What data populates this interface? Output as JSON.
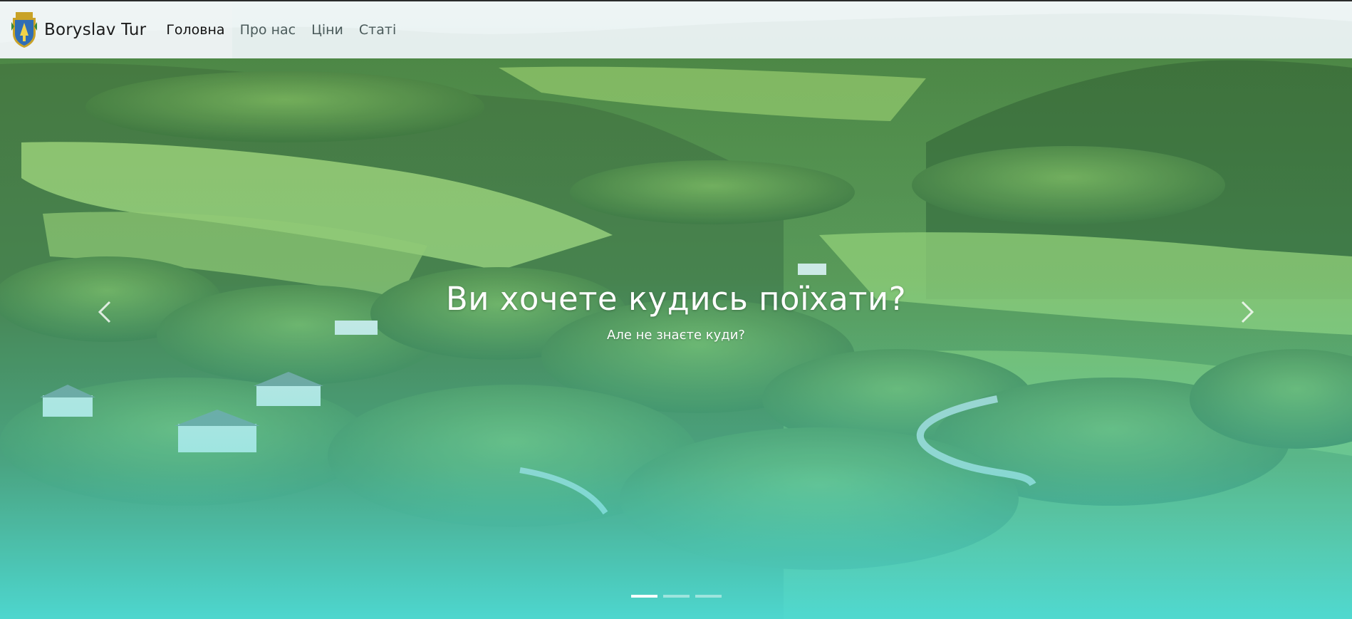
{
  "navbar": {
    "brand_name": "Boryslav Tur",
    "logo_icon": "boryslav-coat-of-arms-icon",
    "links": [
      {
        "label": "Головна",
        "active": true
      },
      {
        "label": "Про нас",
        "active": false
      },
      {
        "label": "Ціни",
        "active": false
      },
      {
        "label": "Статі",
        "active": false
      }
    ]
  },
  "carousel": {
    "title": "Ви хочете кудись поїхати?",
    "subtitle": "Але не знаєте куди?",
    "prev_icon": "chevron-left-icon",
    "next_icon": "chevron-right-icon",
    "slide_count": 3,
    "active_slide": 1
  },
  "colors": {
    "overlay_bottom": "#4fdcd6",
    "foliage_dark": "#3f6b2c",
    "foliage_light": "#8fbf5a",
    "sky": "#f3f6f6"
  }
}
